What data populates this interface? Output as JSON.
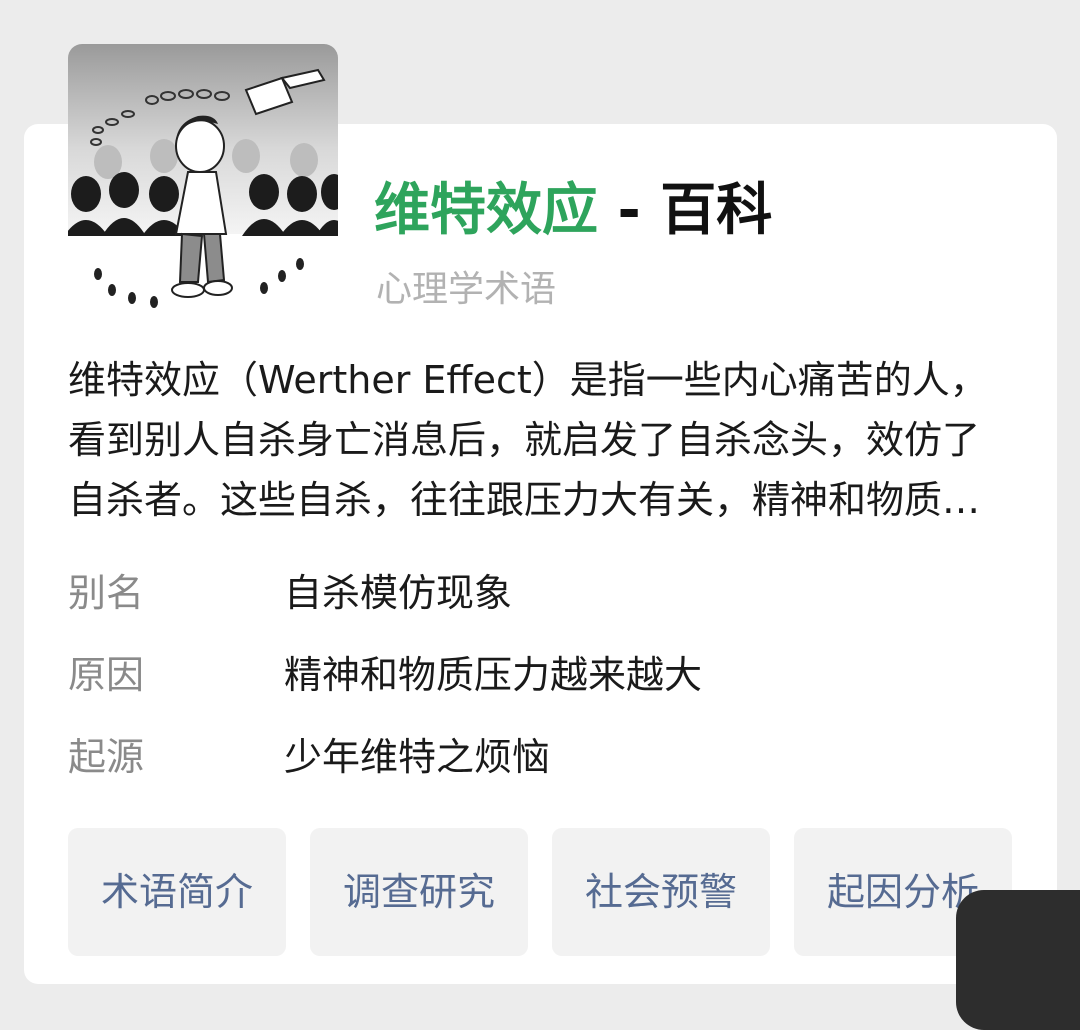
{
  "entry": {
    "title_highlight": "维特效应",
    "title_suffix": " - 百科",
    "subtitle": "心理学术语",
    "description": "维特效应（Werther Effect）是指一些内心痛苦的人，看到别人自杀身亡消息后，就启发了自杀念头，效仿了自杀者。这些自杀，往往跟压力大有关，精神和物质压力越来越大，内心痛苦难以排解。"
  },
  "attributes": [
    {
      "key": "别名",
      "value": "自杀模仿现象"
    },
    {
      "key": "原因",
      "value": "精神和物质压力越来越大"
    },
    {
      "key": "起源",
      "value": "少年维特之烦恼"
    }
  ],
  "tabs": [
    {
      "label": "术语简介"
    },
    {
      "label": "调查研究"
    },
    {
      "label": "社会预警"
    },
    {
      "label": "起因分析"
    }
  ],
  "colors": {
    "highlight": "#2ea45c",
    "tab_text": "#566b92",
    "subtitle": "#b2b2b2"
  }
}
